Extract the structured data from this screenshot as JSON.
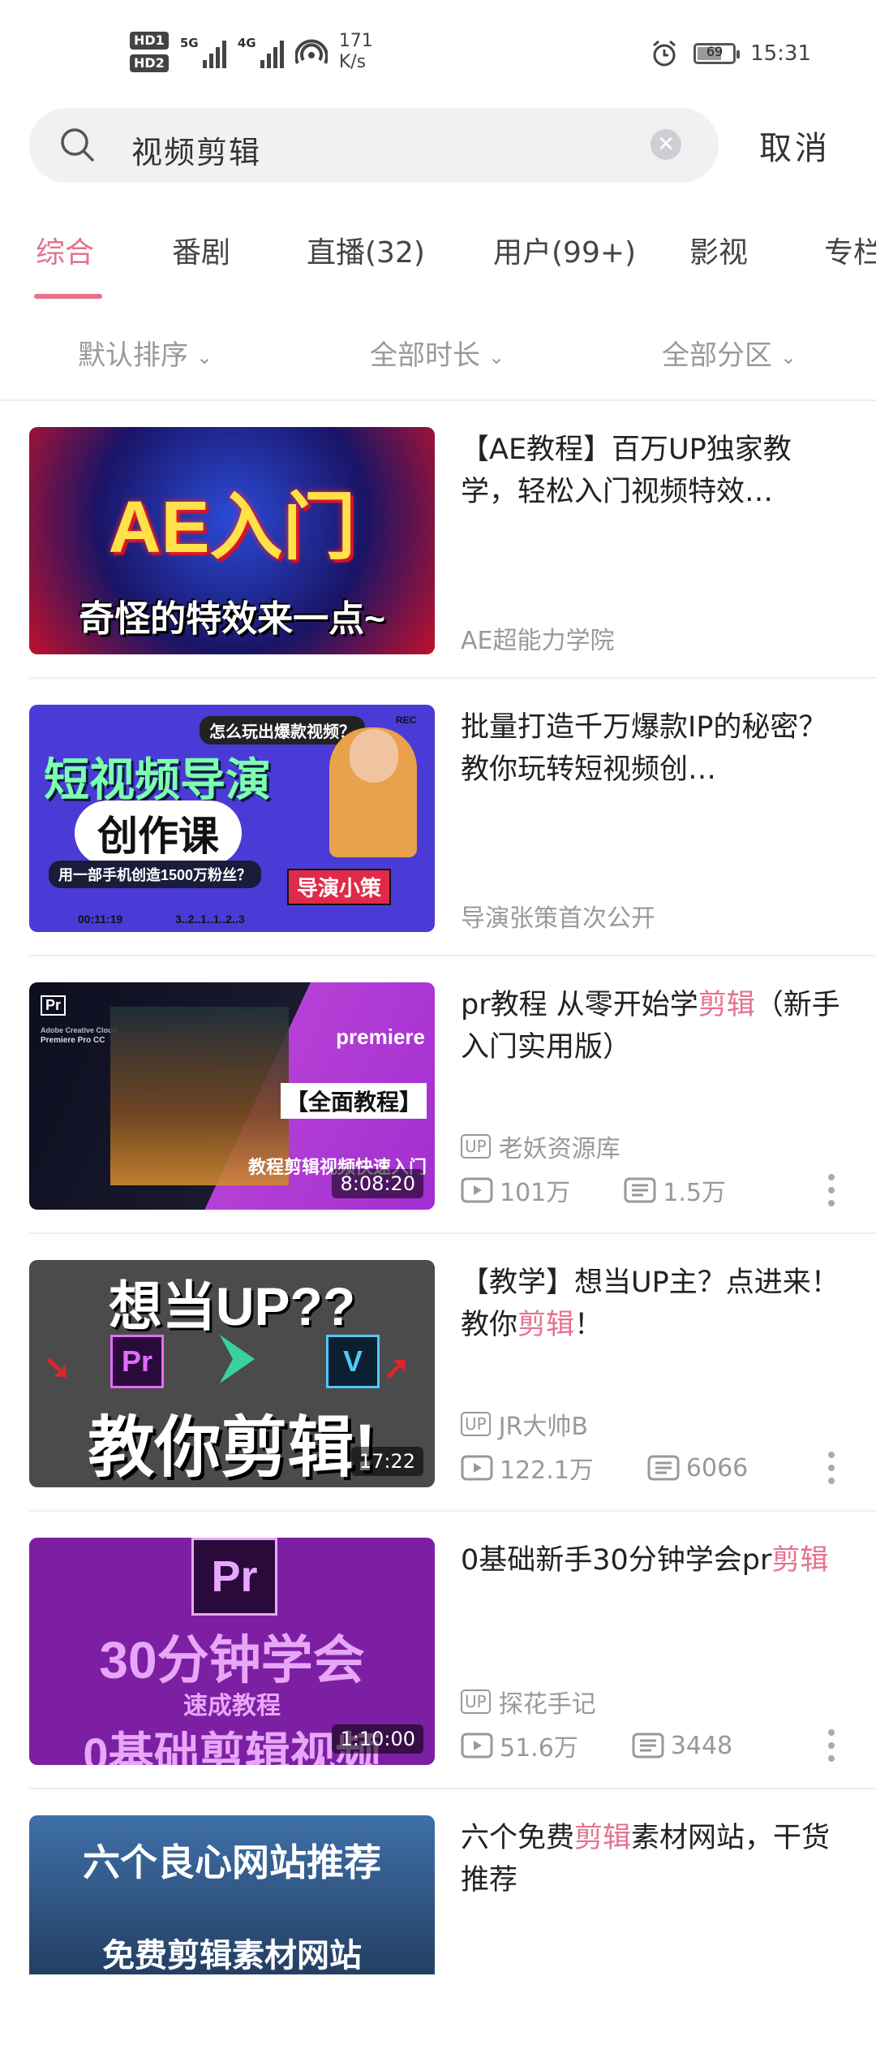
{
  "status_bar": {
    "hd1": "HD1",
    "hd2": "HD2",
    "net1": "5G",
    "net2": "4G",
    "speed_value": "171",
    "speed_unit": "K/s",
    "battery": "69",
    "time": "15:31"
  },
  "search": {
    "query": "视频剪辑",
    "cancel_label": "取消"
  },
  "tabs": [
    {
      "label": "综合",
      "active": true
    },
    {
      "label": "番剧"
    },
    {
      "label": "直播(32)"
    },
    {
      "label": "用户(99+)"
    },
    {
      "label": "影视"
    },
    {
      "label": "专栏"
    }
  ],
  "filters": [
    {
      "label": "默认排序"
    },
    {
      "label": "全部时长"
    },
    {
      "label": "全部分区"
    }
  ],
  "results": [
    {
      "title_pre": "【AE教程】百万UP独家教学，轻松入门视频特效…",
      "title_hl": "",
      "title_post": "",
      "uploader": "AE超能力学院",
      "show_up_badge": false,
      "thumb_text": [
        "AE入门",
        "奇怪的特效来一点~"
      ]
    },
    {
      "title_pre": "批量打造千万爆款IP的秘密？教你玩转短视频创…",
      "title_hl": "",
      "title_post": "",
      "uploader": "导演张策首次公开",
      "show_up_badge": false,
      "thumb_text": [
        "怎么玩出爆款视频？",
        "短视频导演",
        "创作课",
        "用一部手机创造1500万粉丝？",
        "导演小策",
        "00:11:19",
        "3..2..1..1..2..3",
        "REC"
      ]
    },
    {
      "title_pre": "pr教程 从零开始学",
      "title_hl": "剪辑",
      "title_post": "（新手入门实用版）",
      "uploader": "老妖资源库",
      "show_up_badge": true,
      "plays": "101万",
      "danmaku": "1.5万",
      "duration": "8:08:20",
      "thumb_text": [
        "Pr",
        "Adobe Creative Cloud",
        "Premiere Pro CC",
        "premiere",
        "【全面教程】",
        "教程剪辑视频快速入门"
      ]
    },
    {
      "title_pre": "【教学】想当UP主？点进来！教你",
      "title_hl": "剪辑",
      "title_post": "！",
      "uploader": "JR大帅B",
      "show_up_badge": true,
      "plays": "122.1万",
      "danmaku": "6066",
      "duration": "17:22",
      "thumb_text": [
        "想当UP??",
        "Pr",
        "V",
        "教你剪辑!"
      ]
    },
    {
      "title_pre": "0基础新手30分钟学会pr",
      "title_hl": "剪辑",
      "title_post": "",
      "uploader": "探花手记",
      "show_up_badge": true,
      "plays": "51.6万",
      "danmaku": "3448",
      "duration": "1:10:00",
      "thumb_text": [
        "Pr",
        "30分钟学会",
        "速成教程",
        "0基础剪辑视频"
      ]
    },
    {
      "title_pre": "六个免费",
      "title_hl": "剪辑",
      "title_post": "素材网站，干货推荐",
      "uploader": "",
      "show_up_badge": false,
      "thumb_text": [
        "六个良心网站推荐",
        "免费剪辑素材网站"
      ]
    }
  ],
  "colors": {
    "accent": "#e5718f",
    "muted": "#999999"
  }
}
